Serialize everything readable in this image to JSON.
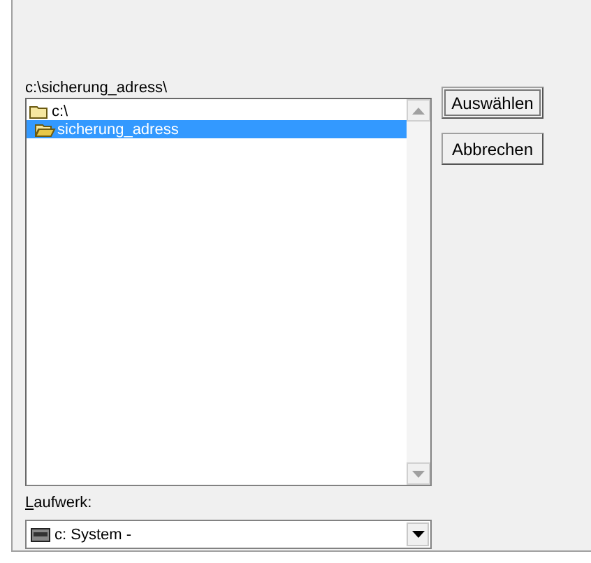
{
  "path_label": "c:\\sicherung_adress\\",
  "folders": [
    {
      "name": "c:\\",
      "kind": "closed",
      "selected": false
    },
    {
      "name": "sicherung_adress",
      "kind": "open",
      "selected": true
    }
  ],
  "buttons": [
    {
      "label": "Auswählen",
      "default": true
    },
    {
      "label": "Abbrechen",
      "default": false
    }
  ],
  "drive_label": {
    "text": "Laufwerk:",
    "mnemonic": true
  },
  "drive_select": {
    "value": "c: System -"
  }
}
